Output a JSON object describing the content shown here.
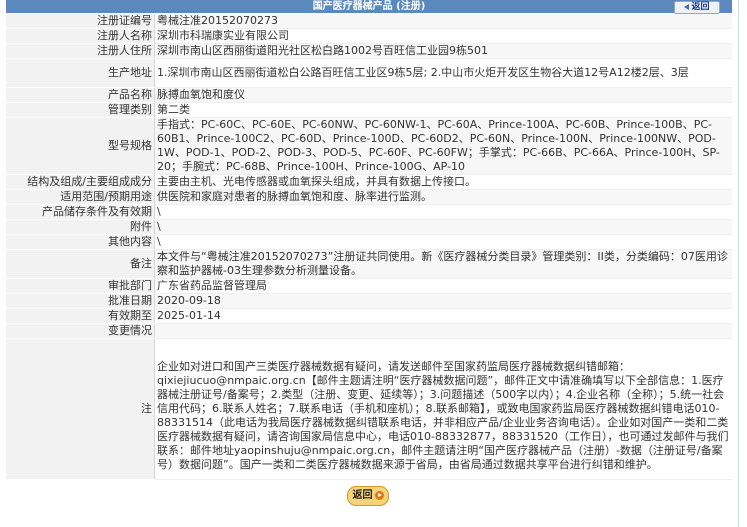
{
  "header": {
    "title": "国产医疗器械产品 (注册)",
    "back_label": "返回"
  },
  "rows": [
    {
      "label": "注册证编号",
      "value": "粤械注准20152070273"
    },
    {
      "label": "注册人名称",
      "value": "深圳市科瑞康实业有限公司"
    },
    {
      "label": "注册人住所",
      "value": "深圳市南山区西丽街道阳光社区松白路1002号百旺信工业园9栋501"
    },
    {
      "label": "生产地址",
      "value": "1.深圳市南山区西丽街道松白公路百旺信工业区9栋5层; 2.中山市火炬开发区生物谷大道12号A12楼2层、3层"
    },
    {
      "label": "产品名称",
      "value": "脉搏血氧饱和度仪"
    },
    {
      "label": "管理类别",
      "value": "第二类"
    },
    {
      "label": "型号规格",
      "value": "手指式：PC-60C、PC-60E、PC-60NW、PC-60NW-1、PC-60A、Prince-100A、PC-60B、Prince-100B、PC-60B1、Prince-100C2、PC-60D、Prince-100D、PC-60D2、PC-60N、Prince-100N、Prince-100NW、POD-1W、POD-1、POD-2、POD-3、POD-5、PC-60F、PC-60FW；手掌式：PC-66B、PC-66A、Prince-100H、SP-20；手腕式：PC-68B、Prince-100H、Prince-100G、AP-10"
    },
    {
      "label": "结构及组成/主要组成成分",
      "value": "主要由主机、光电传感器或血氧探头组成，并具有数据上传接口。"
    },
    {
      "label": "适用范围/预期用途",
      "value": "供医院和家庭对患者的脉搏血氧饱和度、脉率进行监测。"
    },
    {
      "label": "产品储存条件及有效期",
      "value": "\\"
    },
    {
      "label": "附件",
      "value": "\\"
    },
    {
      "label": "其他内容",
      "value": "\\"
    },
    {
      "label": "备注",
      "value": "本文件与“粤械注准20152070273”注册证共同使用。新《医疗器械分类目录》管理类别：II类，分类编码：07医用诊察和监护器械-03生理参数分析测量设备。"
    },
    {
      "label": "审批部门",
      "value": "广东省药品监督管理局"
    },
    {
      "label": "批准日期",
      "value": "2020-09-18"
    },
    {
      "label": "有效期至",
      "value": "2025-01-14"
    },
    {
      "label": "变更情况",
      "value": ""
    },
    {
      "label": "注",
      "value": "企业如对进口和国产三类医疗器械数据有疑问，请发送邮件至国家药监局医疗器械数据纠错邮箱：qixiejiucuo@nmpaic.org.cn【邮件主题请注明“医疗器械数据问题”，邮件正文中请准确填写以下全部信息：1.医疗器械注册证号/备案号；2.类型（注册、变更、延续等）；3.问题描述（500字以内）；4.企业名称（全称）；5.统一社会信用代码；6.联系人姓名；7.联系电话（手机和座机）；8.联系邮箱】，或致电国家药监局医疗器械数据纠错电话010-88331514（此电话为我局医疗器械数据纠错联系电话，并非相应产品/企业业务咨询电话）。企业如对国产一类和二类医疗器械数据有疑问，请咨询国家局信息中心，电话010-88332877，88331520（工作日），也可通过发邮件与我们联系：邮件地址yaopinshuju@nmpaic.org.cn，邮件主题请注明“国产医疗器械产品（注册）-数据（注册证号/备案号）数据问题”。国产一类和二类医疗器械数据来源于省局，由省局通过数据共享平台进行纠错和维护。"
    }
  ],
  "footer": {
    "return_label": "返回"
  }
}
